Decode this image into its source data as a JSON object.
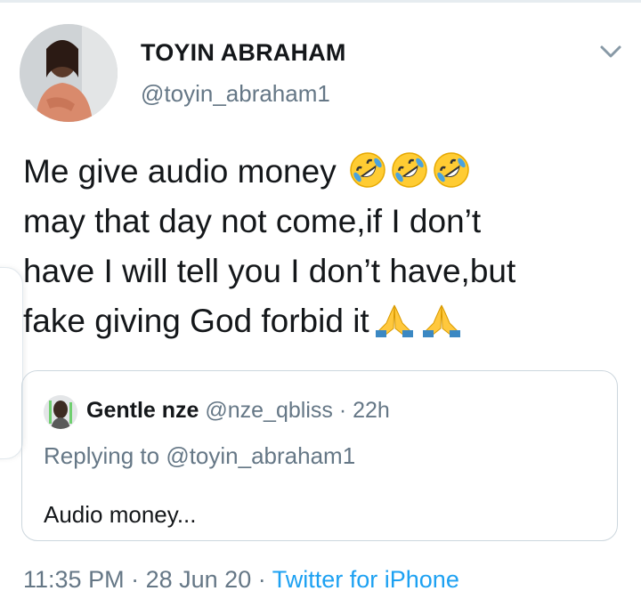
{
  "tweet": {
    "author_name": "TOYIN ABRAHAM",
    "author_handle": "@toyin_abraham1",
    "text_line1": "Me give audio money",
    "text_line2": "may that day not come,if I don’t",
    "text_line3": "have I will tell you I don’t have,but",
    "text_line4": "fake giving God forbid it",
    "emojis_line1": [
      "rolling-on-floor-laughing-emoji",
      "rolling-on-floor-laughing-emoji",
      "rolling-on-floor-laughing-emoji"
    ],
    "emojis_line4": [
      "folded-hands-emoji",
      "folded-hands-emoji"
    ]
  },
  "quoted": {
    "name": "Gentle nze",
    "handle": "@nze_qbliss",
    "separator": "·",
    "time": "22h",
    "replying_prefix": "Replying to",
    "replying_handle": "@toyin_abraham1",
    "text": "Audio money..."
  },
  "footer": {
    "time": "11:35 PM",
    "sep1": "·",
    "date": "28 Jun 20",
    "sep2": "·",
    "source": "Twitter for iPhone"
  },
  "colors": {
    "text": "#14171a",
    "secondary": "#657786",
    "link": "#1da1f2",
    "border": "#ccd6dd"
  },
  "icons": {
    "menu": "chevron-down-icon"
  }
}
